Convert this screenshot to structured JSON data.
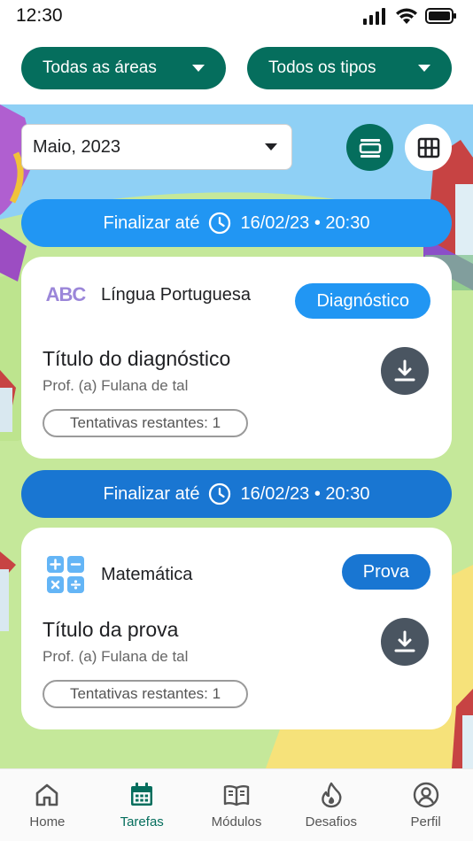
{
  "status_bar": {
    "time": "12:30"
  },
  "filters": {
    "area": "Todas as áreas",
    "type": "Todos os tipos"
  },
  "month_select": {
    "value": "Maio, 2023"
  },
  "colors": {
    "primary": "#056e5d",
    "diagnostic_blue": "#2196f3",
    "exam_blue": "#1976d2",
    "deadline_light": "#2196f3",
    "deadline_dark": "#1976d2"
  },
  "tasks": [
    {
      "deadline_prefix": "Finalizar até",
      "deadline": "16/02/23 • 20:30",
      "subject_icon": "abc-icon",
      "subject_icon_text": "ABC",
      "subject": "Língua Portuguesa",
      "badge": "Diagnóstico",
      "title": "Título do diagnóstico",
      "teacher": "Prof. (a) Fulana de tal",
      "attempts": "Tentativas restantes: 1"
    },
    {
      "deadline_prefix": "Finalizar até",
      "deadline": "16/02/23 • 20:30",
      "subject_icon": "calculator-icon",
      "subject": "Matemática",
      "badge": "Prova",
      "title": "Título da prova",
      "teacher": "Prof. (a) Fulana de tal",
      "attempts": "Tentativas restantes: 1"
    }
  ],
  "nav": [
    {
      "label": "Home",
      "icon": "home-icon",
      "active": false
    },
    {
      "label": "Tarefas",
      "icon": "calendar-icon",
      "active": true
    },
    {
      "label": "Módulos",
      "icon": "book-icon",
      "active": false
    },
    {
      "label": "Desafios",
      "icon": "flame-icon",
      "active": false
    },
    {
      "label": "Perfil",
      "icon": "profile-icon",
      "active": false
    }
  ]
}
